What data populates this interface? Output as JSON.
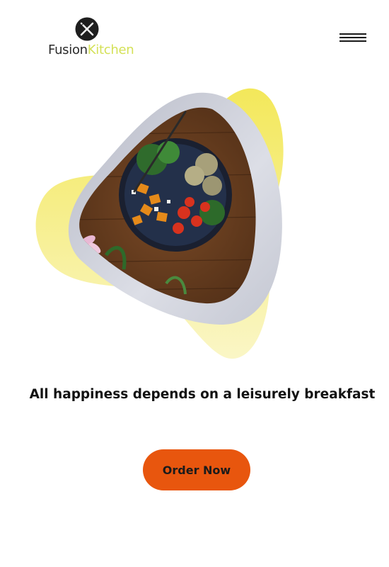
{
  "header": {
    "logo": {
      "text_part1": "Fusion",
      "text_part2": "Kitchen",
      "icon": "fork-knife-icon",
      "accent_color": "#d4e157"
    },
    "menu_icon": "hamburger-menu-icon"
  },
  "hero": {
    "image": "food-bowl-photo",
    "blob_color": "#f5ec6a",
    "frame_color": "#c9ccd6"
  },
  "main": {
    "tagline": "All happiness depends on a leisurely breakfast",
    "cta_label": "Order Now",
    "cta_color": "#e8560e"
  }
}
